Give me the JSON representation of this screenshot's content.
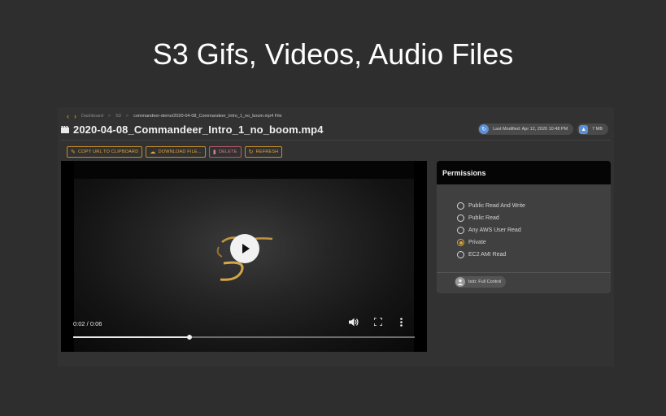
{
  "slide": {
    "title": "S3 Gifs, Videos, Audio Files"
  },
  "breadcrumb": {
    "items": [
      "Dashboard",
      "S3",
      "commandeer-demo/2020-04-08_Commandeer_Intro_1_no_boom.mp4 File"
    ],
    "separator": ">"
  },
  "file": {
    "name": "2020-04-08_Commandeer_Intro_1_no_boom.mp4",
    "last_modified": "Last Modified: Apr 12, 2020 10:48 PM",
    "size": "7 MB"
  },
  "toolbar": {
    "copy_url": "COPY URL TO CLIPBOARD",
    "download": "DOWNLOAD FILE...",
    "delete": "DELETE",
    "refresh": "REFRESH"
  },
  "player": {
    "time": "0:02 / 0:06",
    "progress": 0.34
  },
  "permissions": {
    "title": "Permissions",
    "options": [
      {
        "label": "Public Read And Write",
        "selected": false
      },
      {
        "label": "Public Read",
        "selected": false
      },
      {
        "label": "Any AWS User Read",
        "selected": false
      },
      {
        "label": "Private",
        "selected": true
      },
      {
        "label": "EC2 AMI Read",
        "selected": false
      }
    ],
    "owner": "bob: Full Control"
  },
  "colors": {
    "accent": "#e0a435",
    "danger": "#d77d8a",
    "chip_icon": "#5b8fd6",
    "background": "#2e2e2e"
  }
}
